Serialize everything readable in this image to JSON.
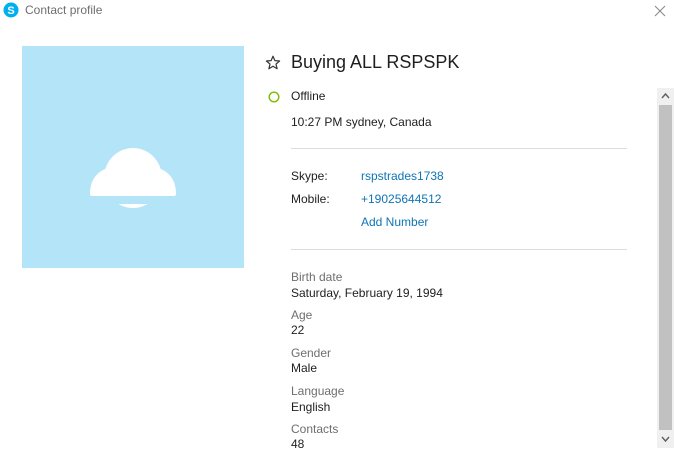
{
  "window": {
    "title": "Contact profile"
  },
  "profile": {
    "display_name": "Buying ALL RSPSPK",
    "status": "Offline",
    "local_time": "10:27 PM sydney, Canada"
  },
  "contact": {
    "skype_label": "Skype:",
    "skype_value": "rspstrades1738",
    "mobile_label": "Mobile:",
    "mobile_value": "+19025644512",
    "add_number_label": "Add Number"
  },
  "details": [
    {
      "label": "Birth date",
      "value": "Saturday, February 19, 1994"
    },
    {
      "label": "Age",
      "value": "22"
    },
    {
      "label": "Gender",
      "value": "Male"
    },
    {
      "label": "Language",
      "value": "English"
    },
    {
      "label": "Contacts",
      "value": "48"
    }
  ],
  "colors": {
    "skype_brand": "#00aff0",
    "link": "#0f75b5",
    "avatar_bg": "#b3e4f8",
    "status_offline": "#7fba00"
  },
  "icons": {
    "app": "skype-icon",
    "close": "close-icon",
    "favorite": "star-icon",
    "status": "status-offline-icon",
    "avatar": "default-avatar-icon",
    "scroll_up": "scroll-up-arrow-icon",
    "scroll_down": "scroll-down-arrow-icon"
  }
}
